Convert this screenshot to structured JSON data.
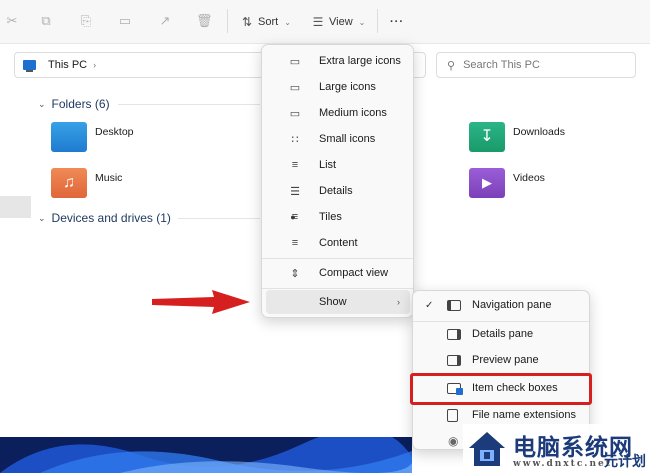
{
  "toolbar": {
    "sort_label": "Sort",
    "view_label": "View",
    "more_label": "···"
  },
  "address": {
    "path": "This PC",
    "search_placeholder": "Search This PC"
  },
  "groups": {
    "folders_header": "Folders (6)",
    "drives_header": "Devices and drives (1)"
  },
  "folders": {
    "desktop": "Desktop",
    "downloads": "Downloads",
    "music": "Music",
    "videos": "Videos"
  },
  "view_menu": {
    "items": [
      {
        "label": "Extra large icons",
        "icon": "monitor-icon"
      },
      {
        "label": "Large icons",
        "icon": "monitor-icon"
      },
      {
        "label": "Medium icons",
        "icon": "monitor-icon"
      },
      {
        "label": "Small icons",
        "icon": "grid-icon"
      },
      {
        "label": "List",
        "icon": "list-icon"
      },
      {
        "label": "Details",
        "icon": "details-icon"
      },
      {
        "label": "Tiles",
        "icon": "tiles-icon",
        "selected": true
      },
      {
        "label": "Content",
        "icon": "content-icon"
      },
      {
        "label": "Compact view",
        "icon": "compact-icon"
      },
      {
        "label": "Show",
        "icon": "",
        "has_submenu": true
      }
    ]
  },
  "show_menu": {
    "items": [
      {
        "label": "Navigation pane",
        "checked": true
      },
      {
        "label": "Details pane",
        "checked": false
      },
      {
        "label": "Preview pane",
        "checked": false
      },
      {
        "label": "Item check boxes",
        "checked": false,
        "highlighted": true
      },
      {
        "label": "File name extensions",
        "checked": false
      }
    ]
  },
  "watermark": {
    "title": "电脑系统网",
    "domain": "www.dnxtc.net",
    "stamp": "元计划"
  },
  "colors": {
    "accent": "#1f6fd1",
    "highlight_red": "#d61f1f",
    "downloads_green": "#1a9a6a",
    "videos_purple": "#7b3fb8",
    "music_orange": "#e0663a"
  }
}
